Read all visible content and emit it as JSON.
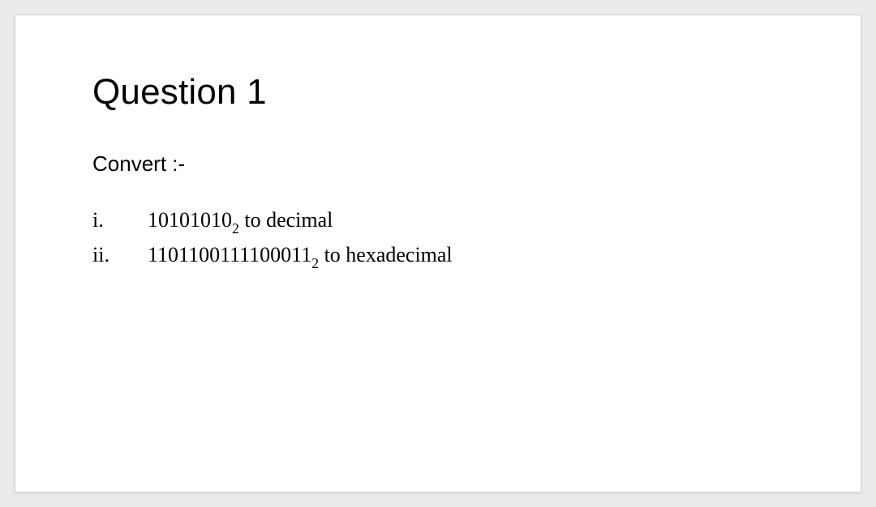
{
  "title": "Question 1",
  "prompt": "Convert :-",
  "items": [
    {
      "marker": "i.",
      "number": "10101010",
      "base": "2",
      "tail": " to decimal"
    },
    {
      "marker": "ii.",
      "number": "1101100111100011",
      "base": "2",
      "tail": " to hexadecimal"
    }
  ]
}
